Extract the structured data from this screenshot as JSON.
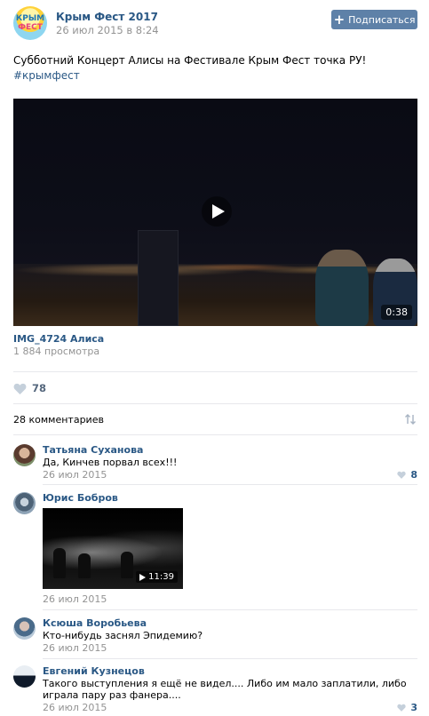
{
  "post": {
    "group_name": "Крым Фест 2017",
    "date": "26 июл 2015 в 8:24",
    "subscribe_label": "Подписаться",
    "text": "Субботний Концерт Алисы на Фестивале Крым Фест точка РУ!",
    "hashtag": "#крымфест",
    "avatar_text_1": "КРЫМ",
    "avatar_text_2": "ФЕСТ",
    "video": {
      "duration": "0:38",
      "title": "IMG_4724 Алиса",
      "views": "1 884 просмотра"
    },
    "likes": "78"
  },
  "comments_header": {
    "count_label": "28 комментариев"
  },
  "comments": [
    {
      "name": "Татьяна Суханова",
      "text": "Да, Кинчев порвал всех!!!",
      "date": "26 июл 2015",
      "likes": "8"
    },
    {
      "name": "Юрис Бобров",
      "date": "26 июл 2015",
      "video_duration": "11:39"
    },
    {
      "name": "Ксюша Воробьева",
      "text": "Кто-нибудь заснял Эпидемию?",
      "date": "26 июл 2015"
    },
    {
      "name": "Евгений Кузнецов",
      "text": "Такого выступления я ещё не видел.... Либо им мало заплатили, либо играла пару раз фанера....",
      "date": "26 июл 2015",
      "likes": "3"
    }
  ],
  "colors": {
    "link": "#2a5885",
    "button": "#5e81a8",
    "muted": "#939393",
    "heart": "#c5d0db"
  }
}
